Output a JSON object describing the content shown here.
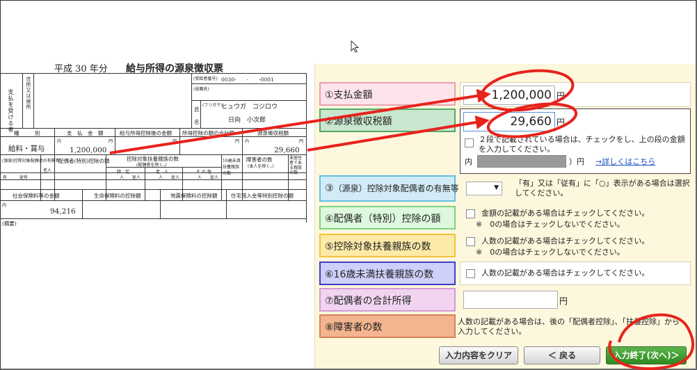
{
  "slip": {
    "year_label": "平成 30 年分",
    "title": "給与所得の源泉徴収票",
    "payee_label_chars": "支払を受ける者",
    "address_label_chars": "住所又は居所",
    "recipient_no_label": "(受給者番号)",
    "recipient_no": "0030-　　-　　-0001",
    "position_label": "(役職名)",
    "furigana_label": "(フリガナ)",
    "furigana": "ヒュウガ　コジロウ",
    "name_label": "氏",
    "name_label2": "名",
    "name": "日向　小次郎",
    "col_type": "種　　　別",
    "col_payment": "支　払　金　額",
    "col_after_deduction": "給与所得控除後の金額",
    "col_deduction_total": "所得控除の額の合計額",
    "col_withholding": "源泉徴収税額",
    "type_value": "給料・賞与",
    "yen_unit": "円",
    "uchi": "内",
    "payment_value": "1,200,000",
    "withholding_value": "29,660",
    "spouse_presence_label": "(源泉)控除対象配偶者の有無等",
    "elderly_label": "老人",
    "spouse_deduction_label": "配偶者(特別)控除の額",
    "dependents_label": "控除対象扶養親族の数",
    "dependents_sub": "(配偶者を除く。)",
    "under16_label": "16歳未満扶養親族の数",
    "disabled_label": "障害者の数",
    "disabled_sub": "(本人を除く。)",
    "nonresident_label": "非居住者である親族の数",
    "tokutei": "特　定",
    "rojin": "老　人",
    "sonota": "そ の 他",
    "jyu": "従人",
    "ari": "有",
    "jyuari": "従有",
    "nin": "人",
    "social_ins_label": "社会保険料等の金額",
    "life_ins_label": "生命保険料の控除額",
    "quake_ins_label": "地震保険料の控除額",
    "housing_label": "住宅借入金等特別控除の額",
    "social_ins_value": "94,216",
    "remarks_label": "(摘要)"
  },
  "form": {
    "rows": [
      {
        "label": "①支払金額",
        "color": "#fde3ea",
        "border": "#e8a0b0"
      },
      {
        "label": "②源泉徴収税額",
        "color": "#c9e7cf",
        "border": "#55a868"
      },
      {
        "label": "③",
        "label_small": "（源泉）控除対象配偶者の有無等",
        "color": "#d2ecf7",
        "border": "#62bfe3"
      },
      {
        "label": "④配偶者（特別）控除の額",
        "color": "#ddf8dd",
        "border": "#7fd27f"
      },
      {
        "label": "⑤控除対象扶養親族の数",
        "color": "#fde9a8",
        "border": "#f3c33d"
      },
      {
        "label": "⑥16歳未満扶養親族の数",
        "color": "#cfd0fa",
        "border": "#3d3dc8"
      },
      {
        "label": "⑦配偶者の合計所得",
        "color": "#f0d4f0",
        "border": "#d49ad4"
      },
      {
        "label": "⑧障害者の数",
        "color": "#f3b48f",
        "border": "#d58255"
      }
    ],
    "payment_value": "1,200,000",
    "withholding_value": "29,660",
    "yen": "円",
    "two_line_note": "２段で記載されている場合は、チェックをし、上の段の金額を入力してください。",
    "uchi_label": "内（",
    "uchi_close": "）円",
    "detail_link": "→詳しくはこちら",
    "spouse_select_value": "",
    "spouse_note": "「有」又は「従有」に「○」表示がある場合は選択してください。",
    "note_amount_check": "金額の記載がある場合はチェックしてください。",
    "note_zero": "※　0の場合はチェックしないでください。",
    "note_count_check": "人数の記載がある場合はチェックしてください。",
    "note_count_check6": "人数の記載がある場合はチェックしてください。",
    "spouse_income_value": "",
    "disabled_note": "人数の記載がある場合は、後の「配偶者控除」、「扶養控除」から入力してください。",
    "btn_clear": "入力内容をクリア",
    "btn_back": "＜ 戻る",
    "btn_finish": "入力終了(次へ)＞"
  },
  "colors": {
    "arrow": "#e8231c",
    "circle": "#e8231c"
  }
}
